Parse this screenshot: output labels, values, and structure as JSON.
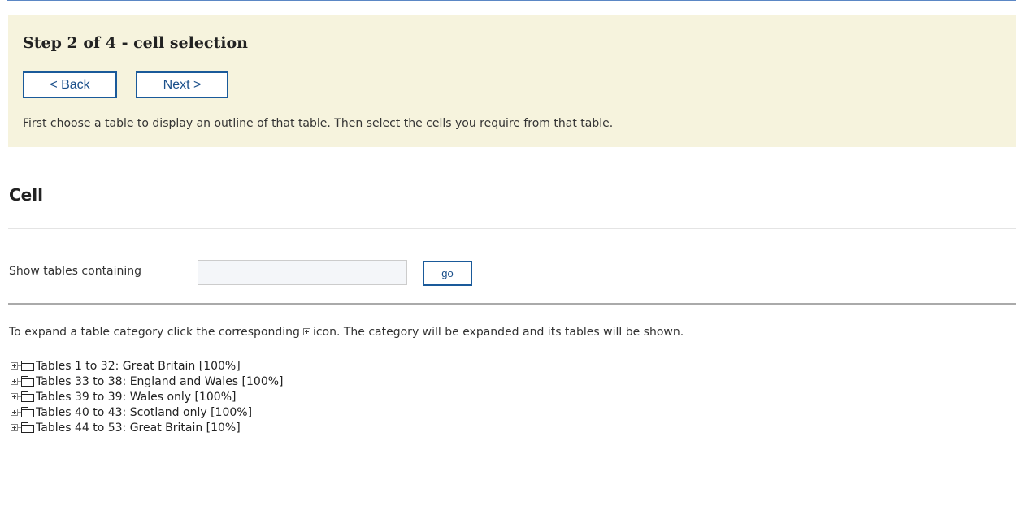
{
  "step": {
    "title": "Step 2 of 4 - cell selection",
    "back_label": "< Back",
    "next_label": "Next >",
    "description": "First choose a table to display an outline of that table. Then select the cells you require from that table."
  },
  "section": {
    "heading": "Cell"
  },
  "search": {
    "label": "Show tables containing",
    "value": "",
    "placeholder": "",
    "go_label": "go"
  },
  "instructions": {
    "before_icon": "To expand a table category click the corresponding",
    "after_icon": "icon. The category will be expanded and its tables will be shown."
  },
  "tree": {
    "items": [
      {
        "label": "Tables 1 to 32: Great Britain [100%]",
        "icon": "folder-icon"
      },
      {
        "label": "Tables 33 to 38: England and Wales [100%]",
        "icon": "folder-icon"
      },
      {
        "label": "Tables 39 to 39: Wales only [100%]",
        "icon": "folder-icon"
      },
      {
        "label": "Tables 40 to 43: Scotland only [100%]",
        "icon": "folder-icon"
      },
      {
        "label": "Tables 44 to 53: Great Britain [10%]",
        "icon": "folder-icon"
      }
    ]
  },
  "colors": {
    "step_panel_bg": "#f6f3dd",
    "button_border": "#1a5a9a",
    "frame_border": "#5b87c5"
  }
}
